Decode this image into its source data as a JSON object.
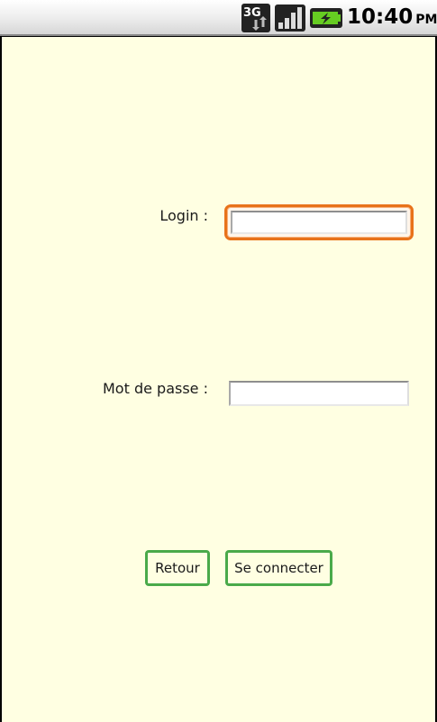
{
  "status_bar": {
    "network_label": "3G",
    "network_icon": "network-3g-icon",
    "signal_icon": "signal-strength-icon",
    "battery_icon": "battery-charging-icon",
    "time": "10:40",
    "ampm": "PM"
  },
  "form": {
    "login_label": "Login :",
    "login_value": "",
    "password_label": "Mot de passe :",
    "password_value": "",
    "back_button_label": "Retour",
    "submit_button_label": "Se connecter"
  },
  "colors": {
    "background": "#ffffe2",
    "focus_border": "#e8721a",
    "button_border": "#4aaa4a"
  }
}
